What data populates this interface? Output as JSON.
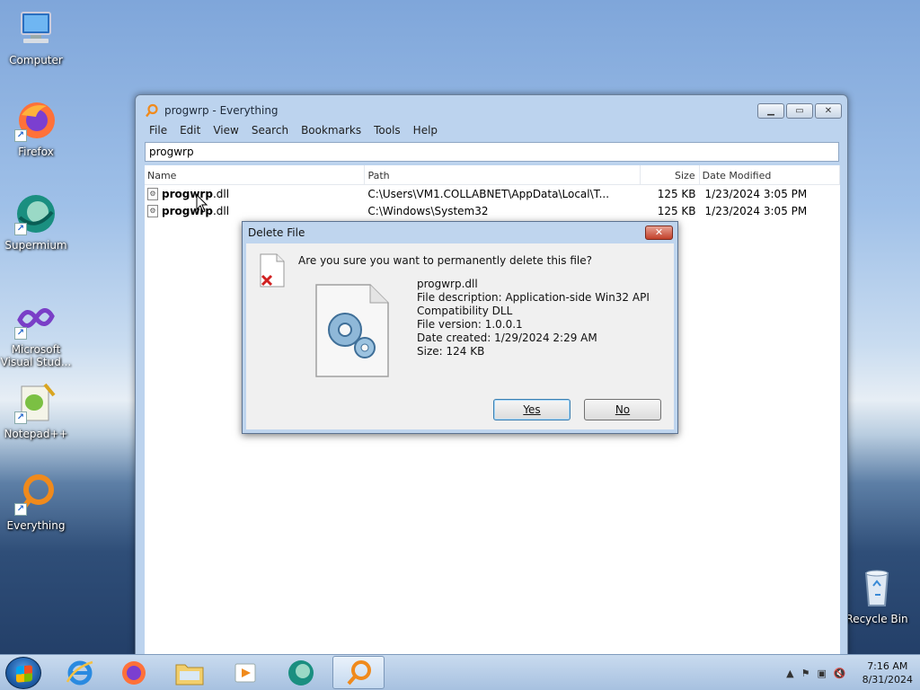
{
  "desktop": {
    "icons": [
      {
        "label": "Computer"
      },
      {
        "label": "Firefox"
      },
      {
        "label": "Supermium"
      },
      {
        "label": "Microsoft Visual Stud..."
      },
      {
        "label": "Notepad++"
      },
      {
        "label": "Everything"
      },
      {
        "label": "Recycle Bin"
      }
    ]
  },
  "window": {
    "title": "progwrp - Everything",
    "menu": [
      "File",
      "Edit",
      "View",
      "Search",
      "Bookmarks",
      "Tools",
      "Help"
    ],
    "search_value": "progwrp",
    "columns": {
      "name": "Name",
      "path": "Path",
      "size": "Size",
      "date": "Date Modified"
    },
    "rows": [
      {
        "name_bold": "progwrp",
        "name_ext": ".dll",
        "path": "C:\\Users\\VM1.COLLABNET\\AppData\\Local\\T...",
        "size": "125 KB",
        "date": "1/23/2024 3:05 PM"
      },
      {
        "name_bold": "progwrp",
        "name_ext": ".dll",
        "path": "C:\\Windows\\System32",
        "size": "125 KB",
        "date": "1/23/2024 3:05 PM"
      }
    ]
  },
  "dialog": {
    "title": "Delete File",
    "question": "Are you sure you want to permanently delete this file?",
    "file_name": "progwrp.dll",
    "file_description": "File description: Application-side Win32 API",
    "file_description_2": "Compatibility DLL",
    "file_version": "File version: 1.0.0.1",
    "date_created": "Date created: 1/29/2024 2:29 AM",
    "size": "Size: 124 KB",
    "yes_label": "Yes",
    "no_label": "No"
  },
  "taskbar": {
    "time": "7:16 AM",
    "date": "8/31/2024"
  },
  "colors": {
    "dialog_bg": "#f0f0f0",
    "close_red": "#c2402a",
    "everything_orange": "#f08a1c"
  }
}
